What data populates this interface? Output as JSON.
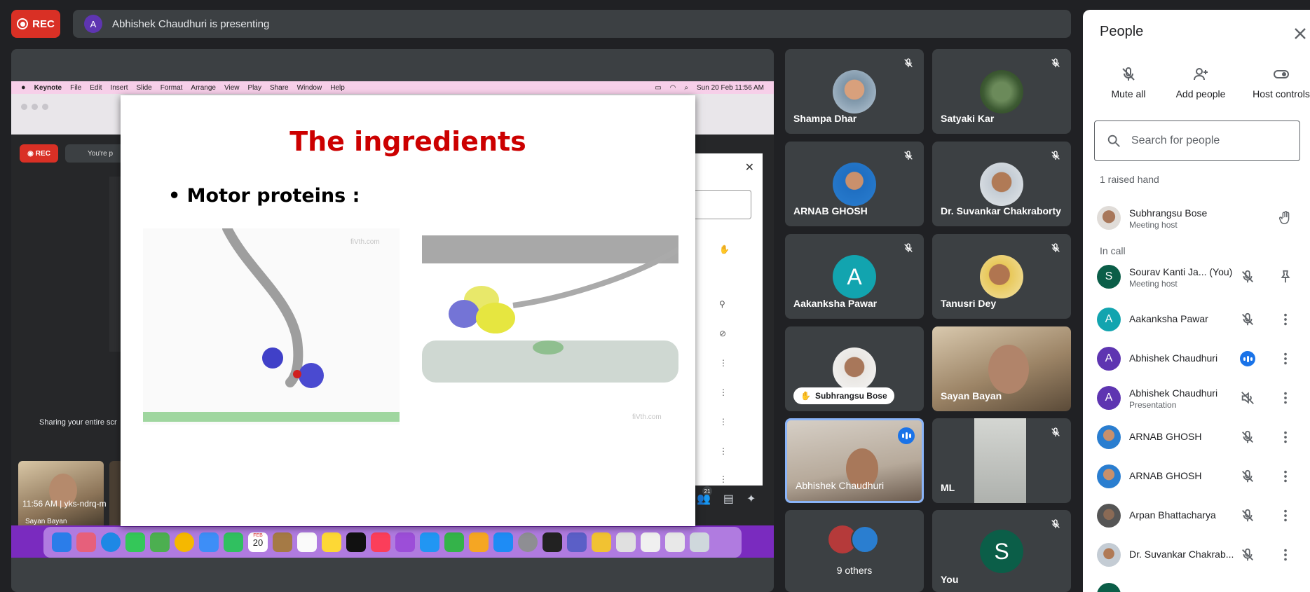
{
  "top": {
    "rec_label": "REC",
    "presenter_initial": "A",
    "presenting_text": "Abhishek Chaudhuri is presenting"
  },
  "shared_screen": {
    "menubar": {
      "app": "Keynote",
      "items": [
        "File",
        "Edit",
        "Insert",
        "Slide",
        "Format",
        "Arrange",
        "View",
        "Play",
        "Share",
        "Window",
        "Help"
      ],
      "clock": "Sun 20 Feb  11:56 AM"
    },
    "inner_meet": {
      "rec_label": "REC",
      "presenting_label": "You're p",
      "sharing_text": "Sharing your entire scr",
      "tile_name": "Sayan Bayan",
      "time_code": "11:56 AM  |  yks-ndrq-m",
      "badge": "21"
    },
    "dock_calendar_month": "FEB",
    "dock_calendar_day": "20",
    "slide": {
      "title": "The ingredients",
      "bullet": "Motor proteins :",
      "watermark": "fiVth.com"
    }
  },
  "tiles": [
    {
      "name": "Shampa Dhar"
    },
    {
      "name": "Satyaki Kar"
    },
    {
      "name": "ARNAB GHOSH"
    },
    {
      "name": "Dr. Suvankar Chakraborty"
    },
    {
      "name": "Aakanksha Pawar",
      "initial": "A"
    },
    {
      "name": "Tanusri Dey"
    },
    {
      "name": "Subhrangsu Bose"
    },
    {
      "name": "Sayan Bayan"
    },
    {
      "name": "Abhishek Chaudhuri"
    },
    {
      "name": "ML"
    },
    {
      "name": "9 others"
    },
    {
      "name": "You",
      "initial": "S"
    }
  ],
  "people": {
    "title": "People",
    "actions": {
      "mute_all": "Mute all",
      "add_people": "Add people",
      "host_controls": "Host controls"
    },
    "search_placeholder": "Search for people",
    "raised_hand_header": "1 raised hand",
    "raised": {
      "name": "Subhrangsu Bose",
      "role": "Meeting host"
    },
    "in_call_header": "In call",
    "rows": [
      {
        "initial": "S",
        "name": "Sourav Kanti Ja...  (You)",
        "role": "Meeting host"
      },
      {
        "initial": "A",
        "name": "Aakanksha Pawar"
      },
      {
        "initial": "A",
        "name": "Abhishek Chaudhuri"
      },
      {
        "initial": "A",
        "name": "Abhishek Chaudhuri",
        "role": "Presentation"
      },
      {
        "name": "ARNAB GHOSH"
      },
      {
        "name": "ARNAB GHOSH"
      },
      {
        "name": "Arpan Bhattacharya"
      },
      {
        "name": "Dr. Suvankar Chakrab..."
      }
    ]
  },
  "colors": {
    "rec_red": "#d93025",
    "meet_dark": "#202124",
    "tile_bg": "#3c4043",
    "accent_blue": "#1a73e8",
    "slide_title_red": "#cc0000",
    "teal_avatar": "#12a4af",
    "purple_avatar": "#5e35b1",
    "green_avatar": "#0b5e48"
  }
}
